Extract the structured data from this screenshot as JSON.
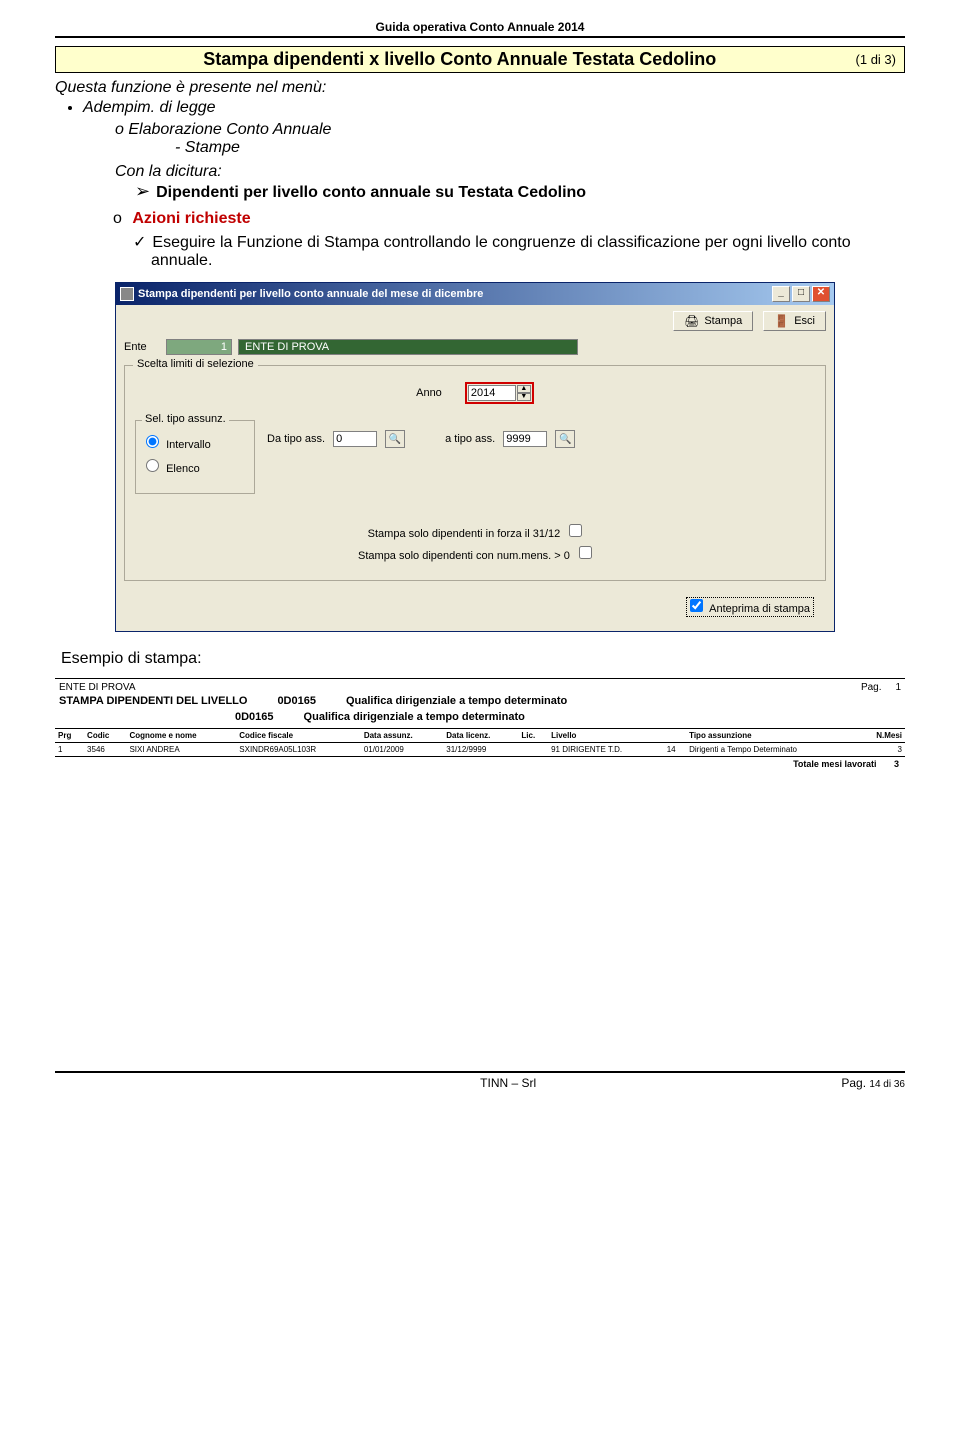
{
  "header": "Guida operativa  Conto Annuale 2014",
  "title_bar": {
    "title": "Stampa dipendenti x livello  Conto Annuale  Testata Cedolino",
    "page_ind": "(1 di 3)"
  },
  "intro": "Questa funzione è presente nel menù:",
  "menu": {
    "item1": "Adempim. di legge",
    "sub_o": "o   Elaborazione Conto Annuale",
    "dash": "-   Stampe"
  },
  "dicitura": "Con la dicitura:",
  "arrow_line": "Dipendenti per livello conto annuale su Testata Cedolino",
  "azioni": {
    "o": "o",
    "label": "Azioni richieste"
  },
  "check_text": "Eseguire la Funzione di Stampa controllando le congruenze di classificazione per ogni livello conto annuale.",
  "dialog": {
    "title": "Stampa dipendenti per livello conto annuale del mese di dicembre",
    "btn_stampa": "Stampa",
    "btn_esci": "Esci",
    "ente_label": "Ente",
    "ente_code": "1",
    "ente_name": "ENTE DI PROVA",
    "group_limiti": "Scelta limiti di selezione",
    "anno_label": "Anno",
    "anno_value": "2014",
    "seltipo_label": "Sel. tipo assunz.",
    "radio_intervallo": "Intervallo",
    "radio_elenco": "Elenco",
    "da_tipo_label": "Da tipo ass.",
    "da_tipo_value": "0",
    "a_tipo_label": "a tipo ass.",
    "a_tipo_value": "9999",
    "chk1": "Stampa solo dipendenti in forza il 31/12",
    "chk2": "Stampa solo dipendenti con num.mens. > 0",
    "ant_stampa": "Anteprima di stampa"
  },
  "esempio": "Esempio di stampa:",
  "report": {
    "ente": "ENTE DI PROVA",
    "pag_label": "Pag.",
    "pag_num": "1",
    "title1_a": "STAMPA DIPENDENTI DEL LIVELLO",
    "title1_b": "0D0165",
    "title1_c": "Qualifica dirigenziale a tempo determinato",
    "title2_a": "0D0165",
    "title2_b": "Qualifica dirigenziale a tempo determinato",
    "cols": {
      "c1": "Prg",
      "c2": "Codic",
      "c3": "Cognome e nome",
      "c4": "Codice fiscale",
      "c5": "Data assunz.",
      "c6": "Data licenz.",
      "c7": "Lic.",
      "c8": "Livello",
      "c9": "Tipo assunzione",
      "c10": "N.Mesi"
    },
    "row": {
      "prg": "1",
      "cod": "3546",
      "nome": "SIXI ANDREA",
      "cf": "SXINDR69A05L103R",
      "dass": "01/01/2009",
      "dlic": "31/12/9999",
      "lic": "",
      "liv": "91 DIRIGENTE T.D.",
      "tipnum": "14",
      "tipo": "Dirigenti a Tempo Determinato",
      "mesi": "3"
    },
    "totale_label": "Totale mesi lavorati",
    "totale_val": "3"
  },
  "footer": {
    "center": "TINN – Srl",
    "right_label": "Pag.",
    "right_val": "14 di 36"
  }
}
